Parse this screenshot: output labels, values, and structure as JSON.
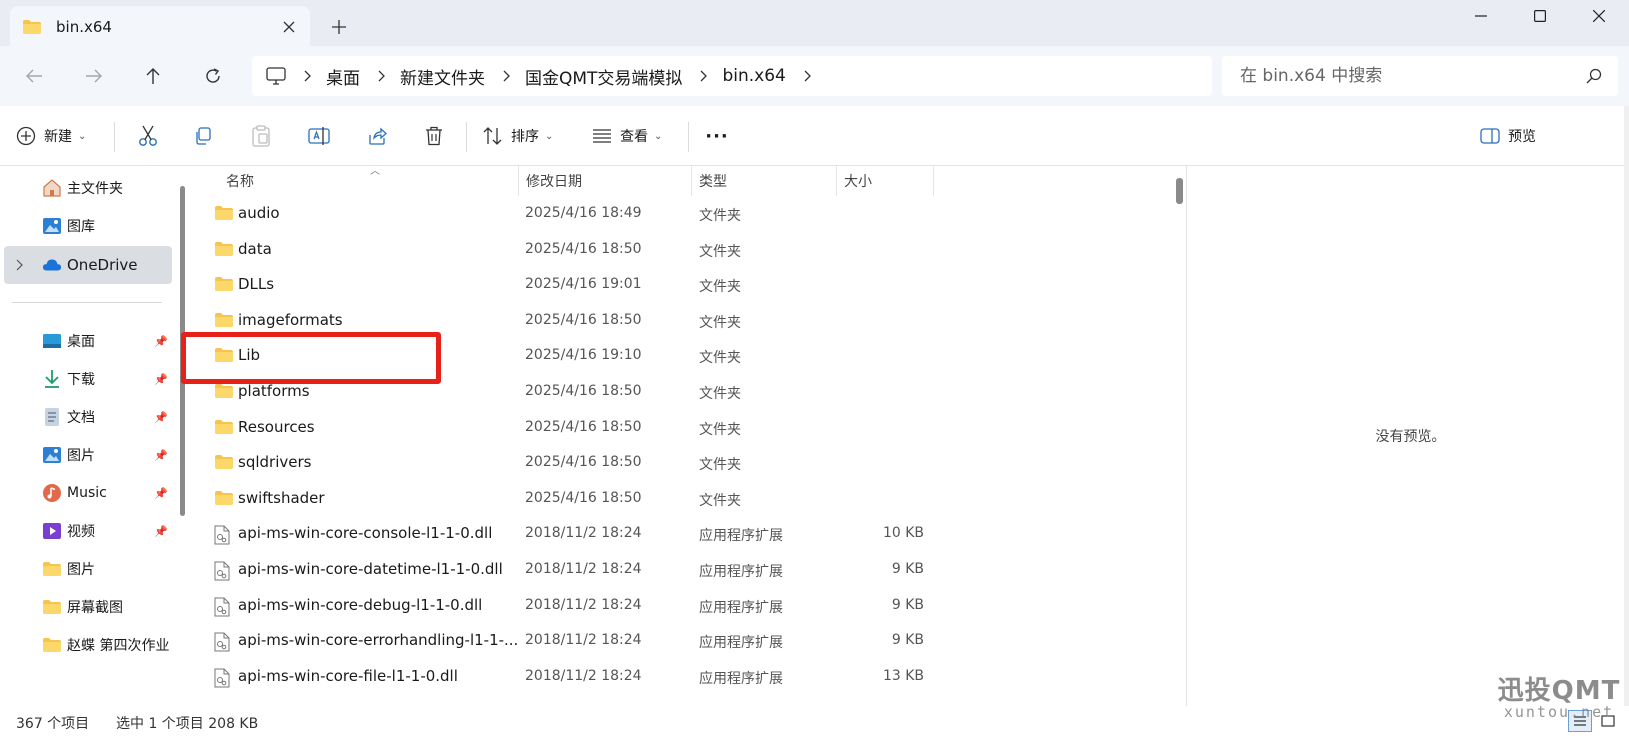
{
  "window": {
    "tab_title": "bin.x64",
    "new_tab": "+",
    "close_tab": "✕"
  },
  "address": {
    "breadcrumbs": [
      "桌面",
      "新建文件夹",
      "国金QMT交易端模拟",
      "bin.x64"
    ],
    "search_placeholder": "在 bin.x64 中搜索"
  },
  "toolbar": {
    "new_label": "新建",
    "sort_label": "排序",
    "view_label": "查看",
    "more_label": "···",
    "preview_label": "预览"
  },
  "sidebar": {
    "top_items": [
      {
        "label": "主文件夹",
        "icon": "home-icon"
      },
      {
        "label": "图库",
        "icon": "gallery-icon"
      },
      {
        "label": "OneDrive",
        "icon": "cloud-icon",
        "selected": true
      }
    ],
    "pinned_items": [
      {
        "label": "桌面",
        "icon": "desktop-icon",
        "pinned": true
      },
      {
        "label": "下载",
        "icon": "download-icon",
        "pinned": true
      },
      {
        "label": "文档",
        "icon": "document-icon",
        "pinned": true
      },
      {
        "label": "图片",
        "icon": "pictures-icon",
        "pinned": true
      },
      {
        "label": "Music",
        "icon": "music-icon",
        "pinned": true
      },
      {
        "label": "视频",
        "icon": "video-icon",
        "pinned": true
      },
      {
        "label": "图片",
        "icon": "folder-icon",
        "pinned": false
      },
      {
        "label": "屏幕截图",
        "icon": "folder-icon",
        "pinned": false
      },
      {
        "label": "赵蝶 第四次作业",
        "icon": "folder-icon",
        "pinned": false
      }
    ]
  },
  "filelist": {
    "columns": [
      "名称",
      "修改日期",
      "类型",
      "大小"
    ],
    "rows": [
      {
        "name": "audio",
        "date": "2025/4/16 18:49",
        "type": "文件夹",
        "size": "",
        "kind": "folder"
      },
      {
        "name": "data",
        "date": "2025/4/16 18:50",
        "type": "文件夹",
        "size": "",
        "kind": "folder"
      },
      {
        "name": "DLLs",
        "date": "2025/4/16 19:01",
        "type": "文件夹",
        "size": "",
        "kind": "folder"
      },
      {
        "name": "imageformats",
        "date": "2025/4/16 18:50",
        "type": "文件夹",
        "size": "",
        "kind": "folder"
      },
      {
        "name": "Lib",
        "date": "2025/4/16 19:10",
        "type": "文件夹",
        "size": "",
        "kind": "folder",
        "highlighted": true
      },
      {
        "name": "platforms",
        "date": "2025/4/16 18:50",
        "type": "文件夹",
        "size": "",
        "kind": "folder"
      },
      {
        "name": "Resources",
        "date": "2025/4/16 18:50",
        "type": "文件夹",
        "size": "",
        "kind": "folder"
      },
      {
        "name": "sqldrivers",
        "date": "2025/4/16 18:50",
        "type": "文件夹",
        "size": "",
        "kind": "folder"
      },
      {
        "name": "swiftshader",
        "date": "2025/4/16 18:50",
        "type": "文件夹",
        "size": "",
        "kind": "folder"
      },
      {
        "name": "api-ms-win-core-console-l1-1-0.dll",
        "date": "2018/11/2 18:24",
        "type": "应用程序扩展",
        "size": "10 KB",
        "kind": "file"
      },
      {
        "name": "api-ms-win-core-datetime-l1-1-0.dll",
        "date": "2018/11/2 18:24",
        "type": "应用程序扩展",
        "size": "9 KB",
        "kind": "file"
      },
      {
        "name": "api-ms-win-core-debug-l1-1-0.dll",
        "date": "2018/11/2 18:24",
        "type": "应用程序扩展",
        "size": "9 KB",
        "kind": "file"
      },
      {
        "name": "api-ms-win-core-errorhandling-l1-1-...",
        "date": "2018/11/2 18:24",
        "type": "应用程序扩展",
        "size": "9 KB",
        "kind": "file"
      },
      {
        "name": "api-ms-win-core-file-l1-1-0.dll",
        "date": "2018/11/2 18:24",
        "type": "应用程序扩展",
        "size": "13 KB",
        "kind": "file"
      }
    ]
  },
  "preview": {
    "empty_text": "没有预览。"
  },
  "status": {
    "item_count": "367 个项目",
    "selection": "选中 1 个项目  208 KB"
  },
  "watermark": {
    "cn": "迅投QMT",
    "en": "xuntou.net"
  },
  "colors": {
    "highlight_box": "#e8201a",
    "folder_yellow": "#f5c451",
    "selected_bg": "#dadde2"
  }
}
